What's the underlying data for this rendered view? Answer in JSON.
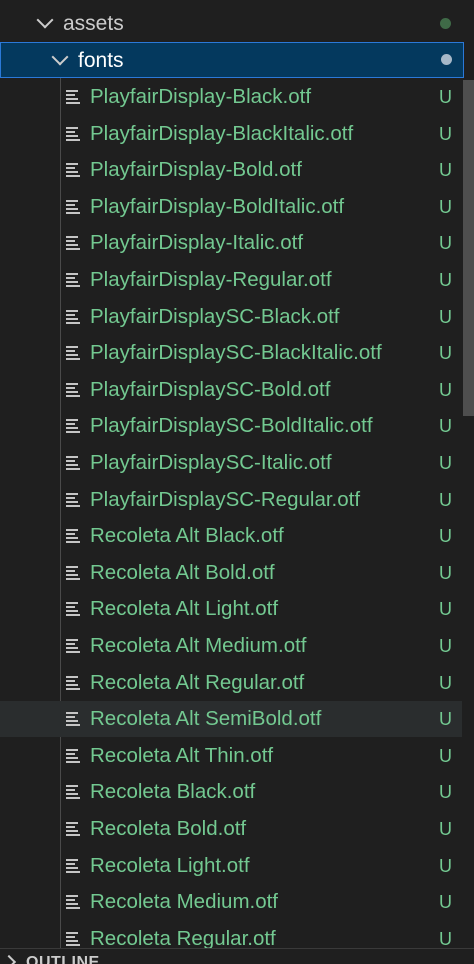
{
  "explorer": {
    "folders": [
      {
        "label": "assets",
        "status_color": "#3f6a47"
      },
      {
        "label": "fonts",
        "status_color": "#a7b8c8"
      }
    ],
    "files": [
      {
        "name": "PlayfairDisplay-Black.otf",
        "status": "U"
      },
      {
        "name": "PlayfairDisplay-BlackItalic.otf",
        "status": "U"
      },
      {
        "name": "PlayfairDisplay-Bold.otf",
        "status": "U"
      },
      {
        "name": "PlayfairDisplay-BoldItalic.otf",
        "status": "U"
      },
      {
        "name": "PlayfairDisplay-Italic.otf",
        "status": "U"
      },
      {
        "name": "PlayfairDisplay-Regular.otf",
        "status": "U"
      },
      {
        "name": "PlayfairDisplaySC-Black.otf",
        "status": "U"
      },
      {
        "name": "PlayfairDisplaySC-BlackItalic.otf",
        "status": "U"
      },
      {
        "name": "PlayfairDisplaySC-Bold.otf",
        "status": "U"
      },
      {
        "name": "PlayfairDisplaySC-BoldItalic.otf",
        "status": "U"
      },
      {
        "name": "PlayfairDisplaySC-Italic.otf",
        "status": "U"
      },
      {
        "name": "PlayfairDisplaySC-Regular.otf",
        "status": "U"
      },
      {
        "name": "Recoleta Alt Black.otf",
        "status": "U"
      },
      {
        "name": "Recoleta Alt Bold.otf",
        "status": "U"
      },
      {
        "name": "Recoleta Alt Light.otf",
        "status": "U"
      },
      {
        "name": "Recoleta Alt Medium.otf",
        "status": "U"
      },
      {
        "name": "Recoleta Alt Regular.otf",
        "status": "U"
      },
      {
        "name": "Recoleta Alt SemiBold.otf",
        "status": "U"
      },
      {
        "name": "Recoleta Alt Thin.otf",
        "status": "U"
      },
      {
        "name": "Recoleta Black.otf",
        "status": "U"
      },
      {
        "name": "Recoleta Bold.otf",
        "status": "U"
      },
      {
        "name": "Recoleta Light.otf",
        "status": "U"
      },
      {
        "name": "Recoleta Medium.otf",
        "status": "U"
      },
      {
        "name": "Recoleta Regular.otf",
        "status": "U"
      }
    ],
    "file_icon": "file-text-icon",
    "untracked_color": "#73c991",
    "selected_color": "#04395e"
  },
  "outline": {
    "label": "OUTLINE"
  }
}
